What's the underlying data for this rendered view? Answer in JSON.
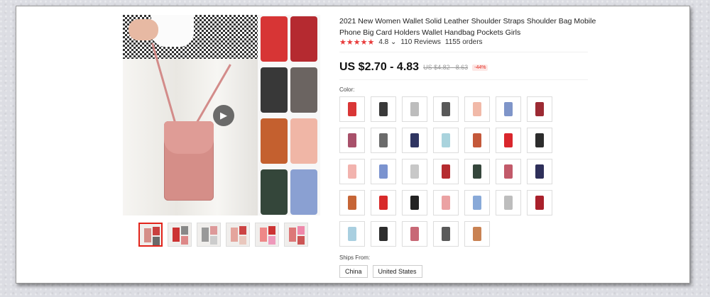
{
  "product": {
    "title": "2021 New Women Wallet Solid Leather Shoulder Straps Shoulder Bag Mobile Phone Big Card Holders Wallet Handbag Pockets Girls",
    "stars": "★★★★★",
    "rating": "4.8",
    "rating_caret": "⌄",
    "reviews": "110 Reviews",
    "orders": "1155 orders"
  },
  "price": {
    "current": "US $2.70 - 4.83",
    "original": "US $4.82 - 8.63",
    "discount": "-44%"
  },
  "color_label": "Color:",
  "swatch_colors": [
    "#d93636",
    "#3a3a3a",
    "#bdbdbd",
    "#585858",
    "#f1b9a8",
    "#7f95c9",
    "#9c2a33",
    "#a8506a",
    "#6b6b6b",
    "#2f3561",
    "#a9d3dd",
    "#c4583a",
    "#d9262c",
    "#2c2c2c",
    "#f2b3ae",
    "#7b93cf",
    "#c8c8c8",
    "#b52b2f",
    "#35463c",
    "#c25a6a",
    "#2e2f5a",
    "#c66536",
    "#d82a2a",
    "#222222",
    "#eba2a3",
    "#88a9d8",
    "#bdbdbd",
    "#a9202b",
    "#a9cfe0",
    "#2d2d2d",
    "#c86876",
    "#5a5a5a",
    "#c98253"
  ],
  "ships_label": "Ships From:",
  "ships_from": [
    "China",
    "United States"
  ],
  "icons": {
    "play": "play-icon"
  }
}
